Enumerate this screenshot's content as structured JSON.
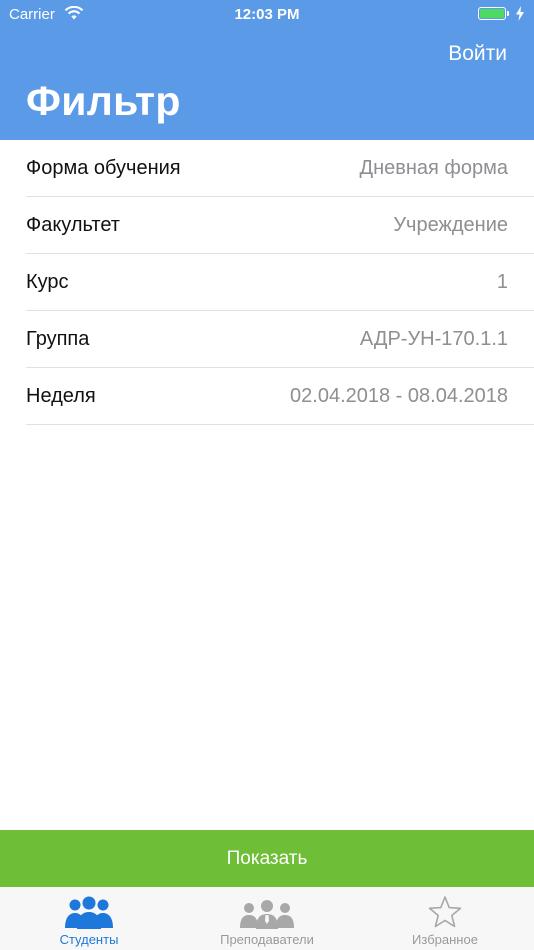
{
  "status_bar": {
    "carrier": "Carrier",
    "time": "12:03 PM",
    "battery_color": "#4cd964"
  },
  "nav": {
    "login_label": "Войти",
    "title": "Фильтр",
    "background_color": "#5a9ae6"
  },
  "filters": [
    {
      "label": "Форма обучения",
      "value": "Дневная форма"
    },
    {
      "label": "Факультет",
      "value": "Учреждение"
    },
    {
      "label": "Курс",
      "value": "1"
    },
    {
      "label": "Группа",
      "value": "АДР-УН-170.1.1"
    },
    {
      "label": "Неделя",
      "value": "02.04.2018 - 08.04.2018"
    }
  ],
  "show_button": {
    "label": "Показать",
    "color": "#6ebe37"
  },
  "tab_bar": {
    "active_color": "#1e78dc",
    "inactive_color": "#9a9a9a",
    "tabs": [
      {
        "label": "Студенты",
        "icon": "students-icon",
        "active": true
      },
      {
        "label": "Преподаватели",
        "icon": "teachers-icon",
        "active": false
      },
      {
        "label": "Избранное",
        "icon": "star-icon",
        "active": false
      }
    ]
  }
}
